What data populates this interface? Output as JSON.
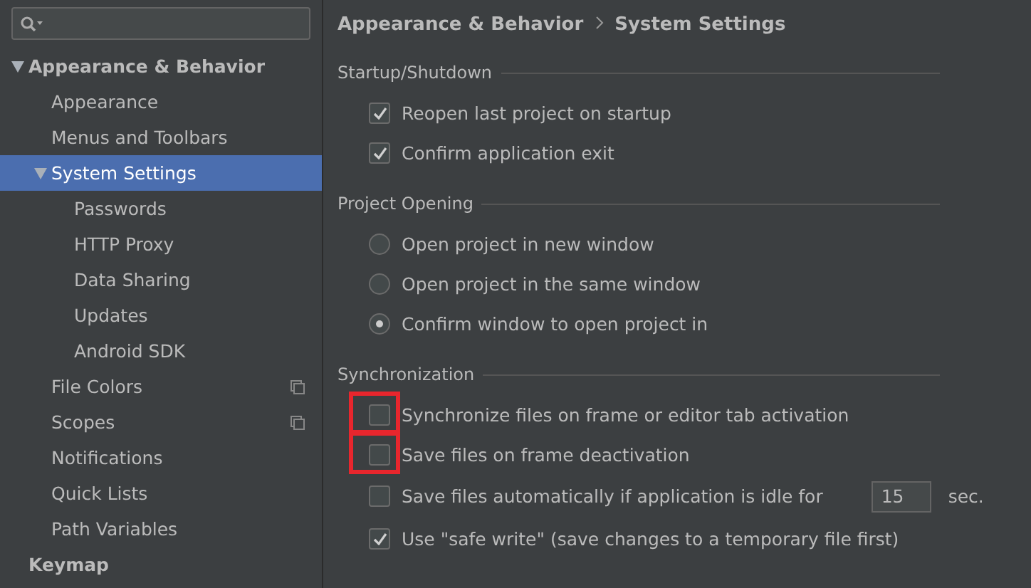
{
  "sidebar": {
    "items": [
      {
        "label": "Appearance & Behavior",
        "bold": true,
        "expanded": true,
        "selected": false,
        "children": [
          {
            "label": "Appearance",
            "selected": false
          },
          {
            "label": "Menus and Toolbars",
            "selected": false
          },
          {
            "label": "System Settings",
            "expanded": true,
            "selected": true,
            "children": [
              {
                "label": "Passwords",
                "selected": false
              },
              {
                "label": "HTTP Proxy",
                "selected": false
              },
              {
                "label": "Data Sharing",
                "selected": false
              },
              {
                "label": "Updates",
                "selected": false
              },
              {
                "label": "Android SDK",
                "selected": false
              }
            ]
          },
          {
            "label": "File Colors",
            "project": true,
            "selected": false
          },
          {
            "label": "Scopes",
            "project": true,
            "selected": false
          },
          {
            "label": "Notifications",
            "selected": false
          },
          {
            "label": "Quick Lists",
            "selected": false
          },
          {
            "label": "Path Variables",
            "selected": false
          }
        ]
      },
      {
        "label": "Keymap",
        "bold": true,
        "selected": false
      }
    ]
  },
  "breadcrumb": [
    "Appearance & Behavior",
    "System Settings"
  ],
  "sections": [
    {
      "title": "Startup/Shutdown",
      "options": [
        {
          "kind": "checkbox",
          "label": "Reopen last project on startup",
          "checked": true
        },
        {
          "kind": "checkbox",
          "label": "Confirm application exit",
          "checked": true
        }
      ]
    },
    {
      "title": "Project Opening",
      "options": [
        {
          "kind": "radio",
          "label": "Open project in new window",
          "selected": false
        },
        {
          "kind": "radio",
          "label": "Open project in the same window",
          "selected": false
        },
        {
          "kind": "radio",
          "label": "Confirm window to open project in",
          "selected": true
        }
      ]
    },
    {
      "title": "Synchronization",
      "options": [
        {
          "kind": "checkbox",
          "label": "Synchronize files on frame or editor tab activation",
          "checked": false,
          "highlighted": true
        },
        {
          "kind": "checkbox",
          "label": "Save files on frame deactivation",
          "checked": false,
          "highlighted": true
        },
        {
          "kind": "checkbox",
          "label": "Save files automatically if application is idle for",
          "checked": false,
          "field": {
            "value": "15",
            "suffix": "sec."
          }
        },
        {
          "kind": "checkbox",
          "label": "Use \"safe write\" (save changes to a temporary file first)",
          "checked": true
        }
      ]
    }
  ]
}
